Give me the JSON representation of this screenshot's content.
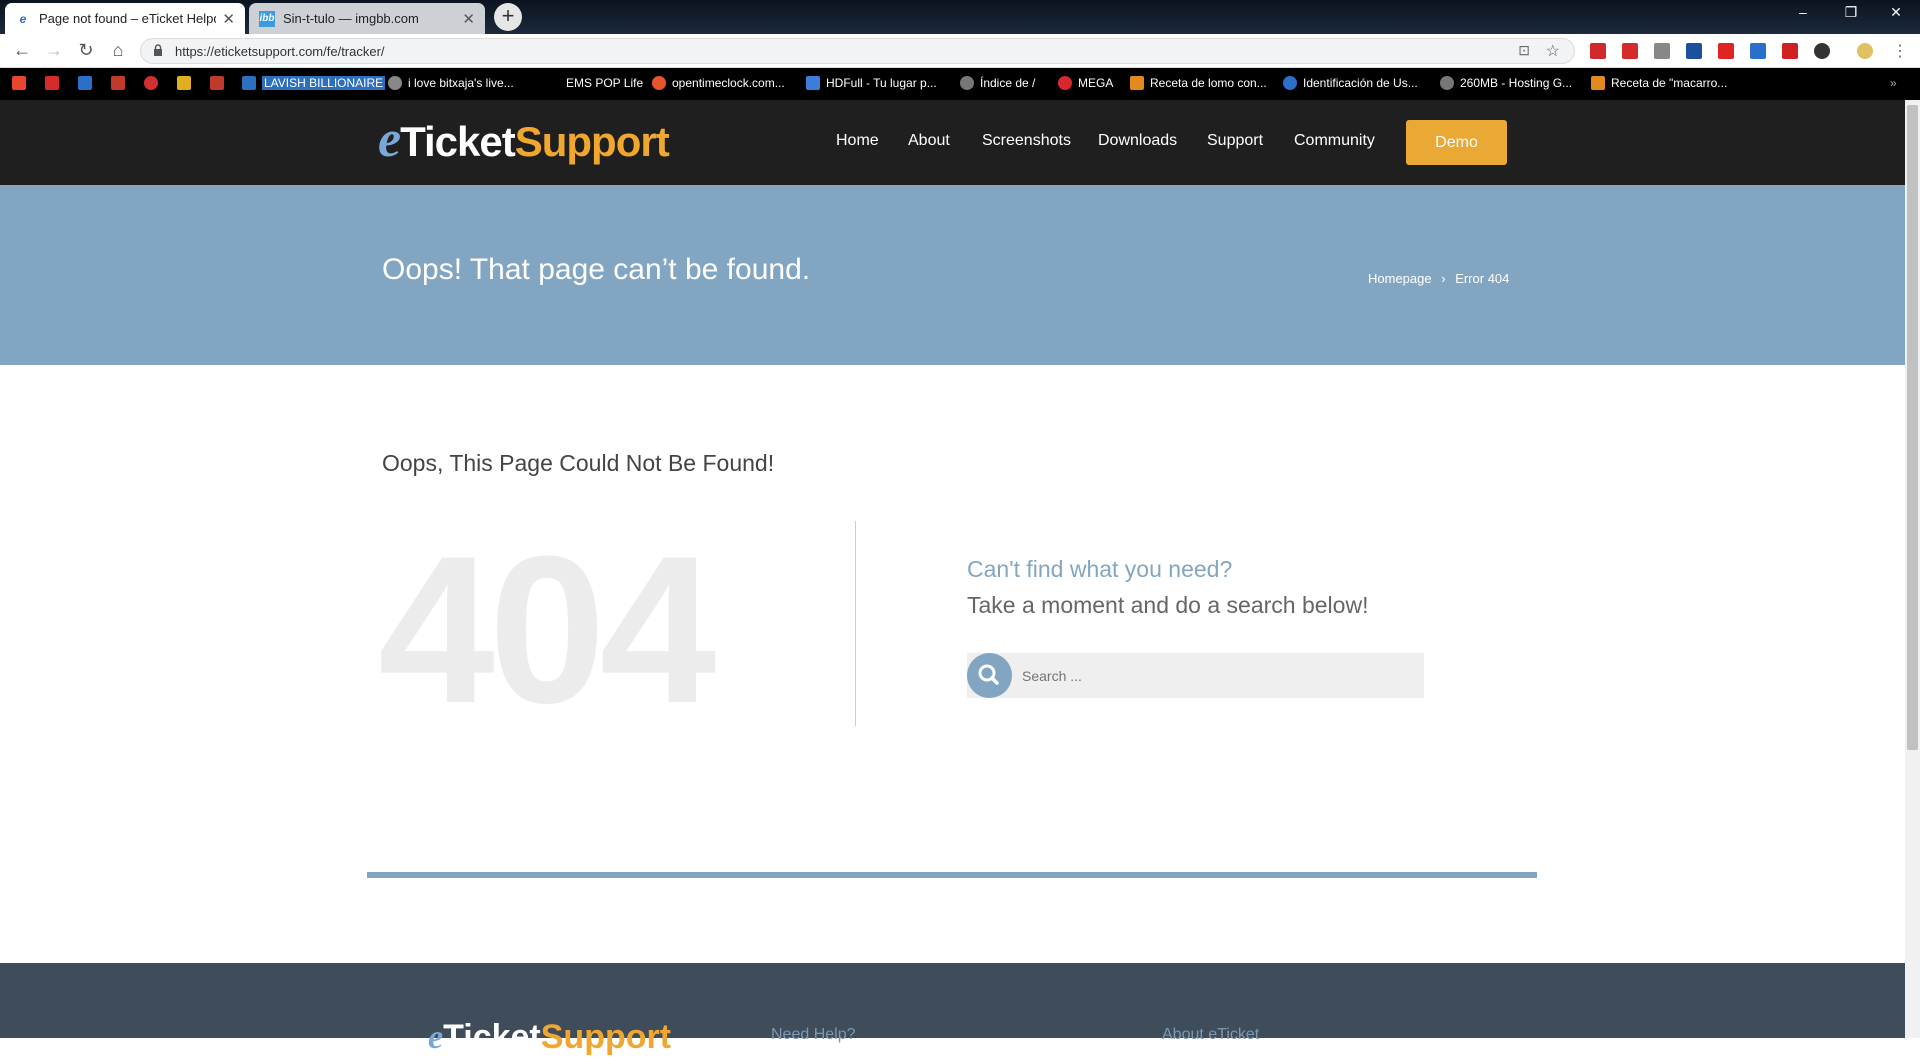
{
  "browser": {
    "tabs": [
      {
        "title": "Page not found – eTicket Helpde",
        "active": true,
        "favicon": "ie-e-icon"
      },
      {
        "title": "Sin-t-tulo — imgbb.com",
        "active": false,
        "favicon": "imgbb-icon"
      }
    ],
    "new_tab": "+",
    "window_controls": {
      "minimize": "–",
      "restore": "❐",
      "close": "✕"
    },
    "url": "https://eticketsupport.com/fe/tracker/",
    "bookmarks": [
      {
        "label": "",
        "icon_color": "#e8452c"
      },
      {
        "label": "",
        "icon_color": "#d62b2b"
      },
      {
        "label": "",
        "icon_color": "#2a6fc9"
      },
      {
        "label": "",
        "icon_color": "#c0392b"
      },
      {
        "label": "",
        "icon_color": "#d03030"
      },
      {
        "label": "",
        "icon_color": "#e0b020"
      },
      {
        "label": "",
        "icon_color": "#c0392b"
      },
      {
        "label": "LAVISH BILLIONAIRE",
        "icon_color": "#2d6fbf"
      },
      {
        "label": "i love bitxaja's live...",
        "icon_color": "#888888"
      },
      {
        "label": "EMS POP Life",
        "icon_color": "#000000"
      },
      {
        "label": "opentimeclock.com...",
        "icon_color": "#e8542c"
      },
      {
        "label": "HDFull - Tu lugar p...",
        "icon_color": "#3b7dd8"
      },
      {
        "label": "Índice de /",
        "icon_color": "#777777"
      },
      {
        "label": "MEGA",
        "icon_color": "#d9272e"
      },
      {
        "label": "Receta de lomo con...",
        "icon_color": "#e08a20"
      },
      {
        "label": "Identificación de Us...",
        "icon_color": "#2a6fc9"
      },
      {
        "label": "260MB - Hosting G...",
        "icon_color": "#777777"
      },
      {
        "label": "Receta de \"macarro...",
        "icon_color": "#e08a20"
      }
    ]
  },
  "site": {
    "logo": {
      "e": "e",
      "ticket": "Ticket",
      "support": "Support"
    },
    "nav": [
      "Home",
      "About",
      "Screenshots",
      "Downloads",
      "Support",
      "Community"
    ],
    "demo_label": "Demo",
    "page_title": "Oops! That page can’t be found.",
    "breadcrumb": {
      "home": "Homepage",
      "sep": "›",
      "current": "Error 404"
    },
    "heading": "Oops, This Page Could Not Be Found!",
    "big_code": "404",
    "help_title": "Can't find what you need?",
    "help_text": "Take a moment and do a search below!",
    "search_placeholder": "Search ...",
    "footer": {
      "col1": "Need Help?",
      "col2": "About eTicket"
    },
    "colors": {
      "accent": "#82a6c2",
      "demo": "#eaa834",
      "header": "#1f1f1f",
      "footer": "#3f4d5a"
    }
  }
}
